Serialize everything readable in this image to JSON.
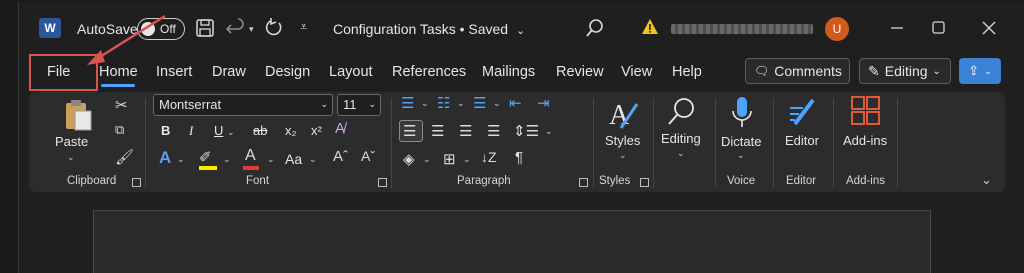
{
  "titlebar": {
    "app_logo": "W",
    "autosave_label": "AutoSave",
    "autosave_state": "Off",
    "doc_title": "Configuration Tasks • Saved",
    "avatar_initial": "U",
    "icons": [
      "save-icon",
      "undo-icon",
      "redo-icon",
      "customize-icon",
      "search-icon",
      "warning-icon",
      "minimize-icon",
      "maximize-icon",
      "close-icon"
    ]
  },
  "tabs": [
    {
      "label": "File"
    },
    {
      "label": "Home"
    },
    {
      "label": "Insert"
    },
    {
      "label": "Draw"
    },
    {
      "label": "Design"
    },
    {
      "label": "Layout"
    },
    {
      "label": "References"
    },
    {
      "label": "Mailings"
    },
    {
      "label": "Review"
    },
    {
      "label": "View"
    },
    {
      "label": "Help"
    }
  ],
  "actions": {
    "comments_label": "Comments",
    "editing_label": "Editing"
  },
  "ribbon": {
    "clipboard": {
      "paste_label": "Paste",
      "group_label": "Clipboard"
    },
    "font": {
      "font_name": "Montserrat",
      "font_size": "11",
      "bold": "B",
      "italic": "I",
      "underline": "U",
      "strike": "ab",
      "subscript": "x₂",
      "superscript": "x²",
      "change_case": "Aa",
      "group_label": "Font"
    },
    "paragraph": {
      "group_label": "Paragraph",
      "pilcrow": "¶"
    },
    "styles": {
      "label": "Styles",
      "group_label": "Styles"
    },
    "editing": {
      "label": "Editing"
    },
    "voice": {
      "dictate_label": "Dictate",
      "group_label": "Voice"
    },
    "editor": {
      "label": "Editor",
      "group_label": "Editor"
    },
    "addins": {
      "label": "Add-ins",
      "group_label": "Add-ins"
    }
  },
  "colors": {
    "highlight_box": "#d9534f",
    "accent": "#4fa3ff",
    "share": "#3b82d6",
    "highlight_bar": "#ffe600",
    "font_color_bar": "#e03a3a",
    "avatar": "#d25a1e"
  }
}
